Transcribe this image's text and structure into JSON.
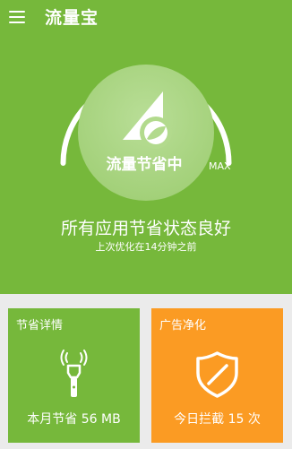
{
  "app_bar": {
    "title": "流量宝",
    "menu_icon": "hamburger-menu-icon"
  },
  "gauge": {
    "label": "流量节省中",
    "max_label": "MAX",
    "icon": "signal-leaf-icon"
  },
  "status": {
    "main": "所有应用节省状态良好",
    "sub": "上次优化在14分钟之前"
  },
  "cards": {
    "savings": {
      "title": "节省详情",
      "value": "本月节省 56 MB",
      "icon": "flashlight-icon"
    },
    "ad_block": {
      "title": "广告净化",
      "value": "今日拦截 15 次",
      "icon": "shield-icon"
    }
  },
  "colors": {
    "primary_green": "#76b83b",
    "orange": "#fb9b23",
    "background": "#ebebeb"
  }
}
